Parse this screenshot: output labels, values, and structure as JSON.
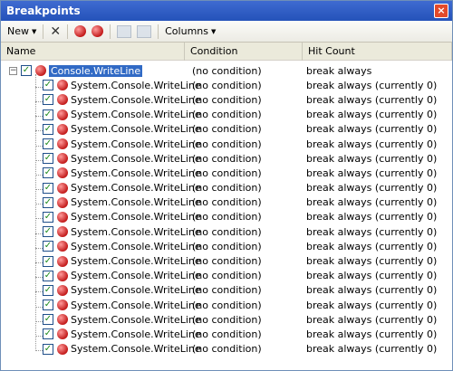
{
  "window": {
    "title": "Breakpoints",
    "close_label": "×"
  },
  "toolbar": {
    "new_label": "New",
    "columns_label": "Columns"
  },
  "columns": {
    "name": "Name",
    "condition": "Condition",
    "hit_count": "Hit Count"
  },
  "parent": {
    "name": "Console.WriteLine",
    "condition": "(no condition)",
    "hit_count": "break always"
  },
  "children": [
    {
      "name": "System.Console.WriteLine",
      "condition": "(no condition)",
      "hit_count": "break always (currently 0)"
    },
    {
      "name": "System.Console.WriteLine",
      "condition": "(no condition)",
      "hit_count": "break always (currently 0)"
    },
    {
      "name": "System.Console.WriteLine",
      "condition": "(no condition)",
      "hit_count": "break always (currently 0)"
    },
    {
      "name": "System.Console.WriteLine",
      "condition": "(no condition)",
      "hit_count": "break always (currently 0)"
    },
    {
      "name": "System.Console.WriteLine",
      "condition": "(no condition)",
      "hit_count": "break always (currently 0)"
    },
    {
      "name": "System.Console.WriteLine",
      "condition": "(no condition)",
      "hit_count": "break always (currently 0)"
    },
    {
      "name": "System.Console.WriteLine",
      "condition": "(no condition)",
      "hit_count": "break always (currently 0)"
    },
    {
      "name": "System.Console.WriteLine",
      "condition": "(no condition)",
      "hit_count": "break always (currently 0)"
    },
    {
      "name": "System.Console.WriteLine",
      "condition": "(no condition)",
      "hit_count": "break always (currently 0)"
    },
    {
      "name": "System.Console.WriteLine",
      "condition": "(no condition)",
      "hit_count": "break always (currently 0)"
    },
    {
      "name": "System.Console.WriteLine",
      "condition": "(no condition)",
      "hit_count": "break always (currently 0)"
    },
    {
      "name": "System.Console.WriteLine",
      "condition": "(no condition)",
      "hit_count": "break always (currently 0)"
    },
    {
      "name": "System.Console.WriteLine",
      "condition": "(no condition)",
      "hit_count": "break always (currently 0)"
    },
    {
      "name": "System.Console.WriteLine",
      "condition": "(no condition)",
      "hit_count": "break always (currently 0)"
    },
    {
      "name": "System.Console.WriteLine",
      "condition": "(no condition)",
      "hit_count": "break always (currently 0)"
    },
    {
      "name": "System.Console.WriteLine",
      "condition": "(no condition)",
      "hit_count": "break always (currently 0)"
    },
    {
      "name": "System.Console.WriteLine",
      "condition": "(no condition)",
      "hit_count": "break always (currently 0)"
    },
    {
      "name": "System.Console.WriteLine",
      "condition": "(no condition)",
      "hit_count": "break always (currently 0)"
    },
    {
      "name": "System.Console.WriteLine",
      "condition": "(no condition)",
      "hit_count": "break always (currently 0)"
    }
  ],
  "icons": {
    "delete": "delete-icon",
    "breakpoint": "breakpoint-icon",
    "checkbox_checked": "checkbox-checked-icon",
    "expander": "collapse-icon"
  },
  "colors": {
    "titlebar": "#2452b9",
    "selection": "#316ac5",
    "breakpoint": "#c31b1b"
  }
}
